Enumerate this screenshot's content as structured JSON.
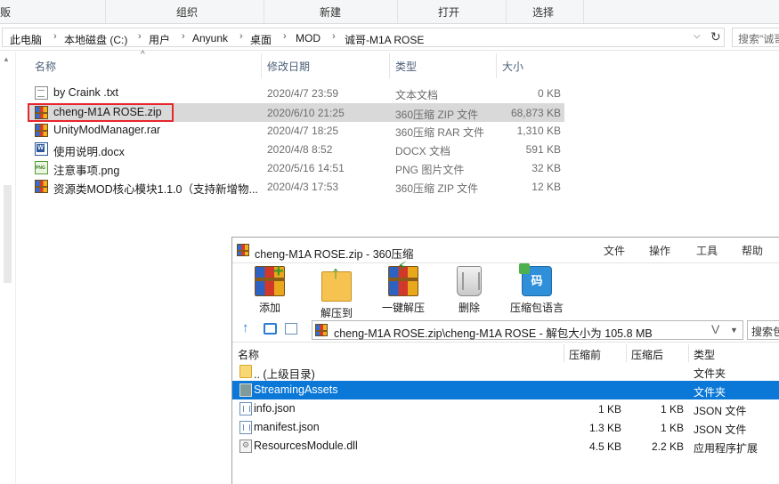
{
  "explorer": {
    "ribbon": {
      "left_partial": "贩",
      "groups": [
        "组织",
        "新建",
        "打开",
        "选择"
      ]
    },
    "breadcrumb": [
      "此电脑",
      "本地磁盘 (C:)",
      "用户",
      "Anyunk",
      "桌面",
      "MOD",
      "诚哥-M1A ROSE"
    ],
    "search_placeholder": "搜索\"诚哥",
    "columns": [
      "名称",
      "修改日期",
      "类型",
      "大小"
    ],
    "files": [
      {
        "name": "by Craink .txt",
        "date": "2020/4/7 23:59",
        "type": "文本文档",
        "size": "0 KB",
        "icon": "text-file-icon"
      },
      {
        "name": "cheng-M1A ROSE.zip",
        "date": "2020/6/10 21:25",
        "type": "360压缩 ZIP 文件",
        "size": "68,873 KB",
        "icon": "zip-archive-icon"
      },
      {
        "name": "UnityModManager.rar",
        "date": "2020/4/7 18:25",
        "type": "360压缩 RAR 文件",
        "size": "1,310 KB",
        "icon": "rar-archive-icon"
      },
      {
        "name": "使用说明.docx",
        "date": "2020/4/8 8:52",
        "type": "DOCX 文档",
        "size": "591 KB",
        "icon": "word-doc-icon"
      },
      {
        "name": "注意事项.png",
        "date": "2020/5/16 14:51",
        "type": "PNG 图片文件",
        "size": "32 KB",
        "icon": "png-image-icon"
      },
      {
        "name": "资源类MOD核心模块1.1.0（支持新增物...",
        "date": "2020/4/3 17:53",
        "type": "360压缩 ZIP 文件",
        "size": "12 KB",
        "icon": "zip-archive-icon"
      }
    ]
  },
  "zip_window": {
    "title": "cheng-M1A ROSE.zip - 360压缩",
    "menu": [
      "文件",
      "操作",
      "工具",
      "帮助"
    ],
    "toolbar": [
      {
        "label": "添加",
        "icon": "add-to-archive-icon"
      },
      {
        "label": "解压到",
        "icon": "extract-to-icon"
      },
      {
        "label": "一键解压",
        "icon": "one-click-extract-icon"
      },
      {
        "label": "删除",
        "icon": "delete-trash-icon"
      },
      {
        "label": "压缩包语言",
        "icon": "archive-language-icon"
      }
    ],
    "path": "cheng-M1A ROSE.zip\\cheng-M1A ROSE - 解包大小为 105.8 MB",
    "search_placeholder": "搜索包",
    "columns": [
      "名称",
      "压缩前",
      "压缩后",
      "类型"
    ],
    "entries": [
      {
        "name": ".. (上级目录)",
        "before": "",
        "after": "",
        "type": "文件夹",
        "icon": "parent-folder-icon"
      },
      {
        "name": "StreamingAssets",
        "before": "",
        "after": "",
        "type": "文件夹",
        "icon": "folder-icon"
      },
      {
        "name": "info.json",
        "before": "1 KB",
        "after": "1 KB",
        "type": "JSON 文件",
        "icon": "json-file-icon"
      },
      {
        "name": "manifest.json",
        "before": "1.3 KB",
        "after": "1 KB",
        "type": "JSON 文件",
        "icon": "json-file-icon"
      },
      {
        "name": "ResourcesModule.dll",
        "before": "4.5 KB",
        "after": "2.2 KB",
        "type": "应用程序扩展",
        "icon": "dll-file-icon"
      }
    ]
  },
  "colors": {
    "selection_explorer": "#d9d9d9",
    "selection_zip": "#0b78d7",
    "highlight_box": "#e8262e"
  }
}
